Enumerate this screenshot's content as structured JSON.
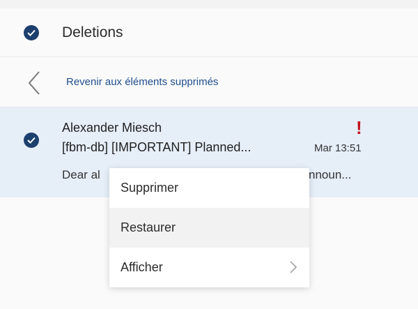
{
  "folder": {
    "title": "Deletions"
  },
  "nav": {
    "back_link": "Revenir aux éléments supprimés"
  },
  "message": {
    "sender": "Alexander Miesch",
    "subject": "[fbm-db] [IMPORTANT] Planned...",
    "date": "Mar 13:51",
    "preview_start": "Dear al",
    "preview_end": "nnoun...",
    "importance": "!"
  },
  "context_menu": {
    "items": [
      {
        "label": "Supprimer"
      },
      {
        "label": "Restaurer"
      },
      {
        "label": "Afficher"
      }
    ]
  },
  "colors": {
    "accent": "#1d3f6e",
    "link": "#1f4e8c",
    "selected_row": "#e6eef8",
    "importance": "#c0101b"
  }
}
